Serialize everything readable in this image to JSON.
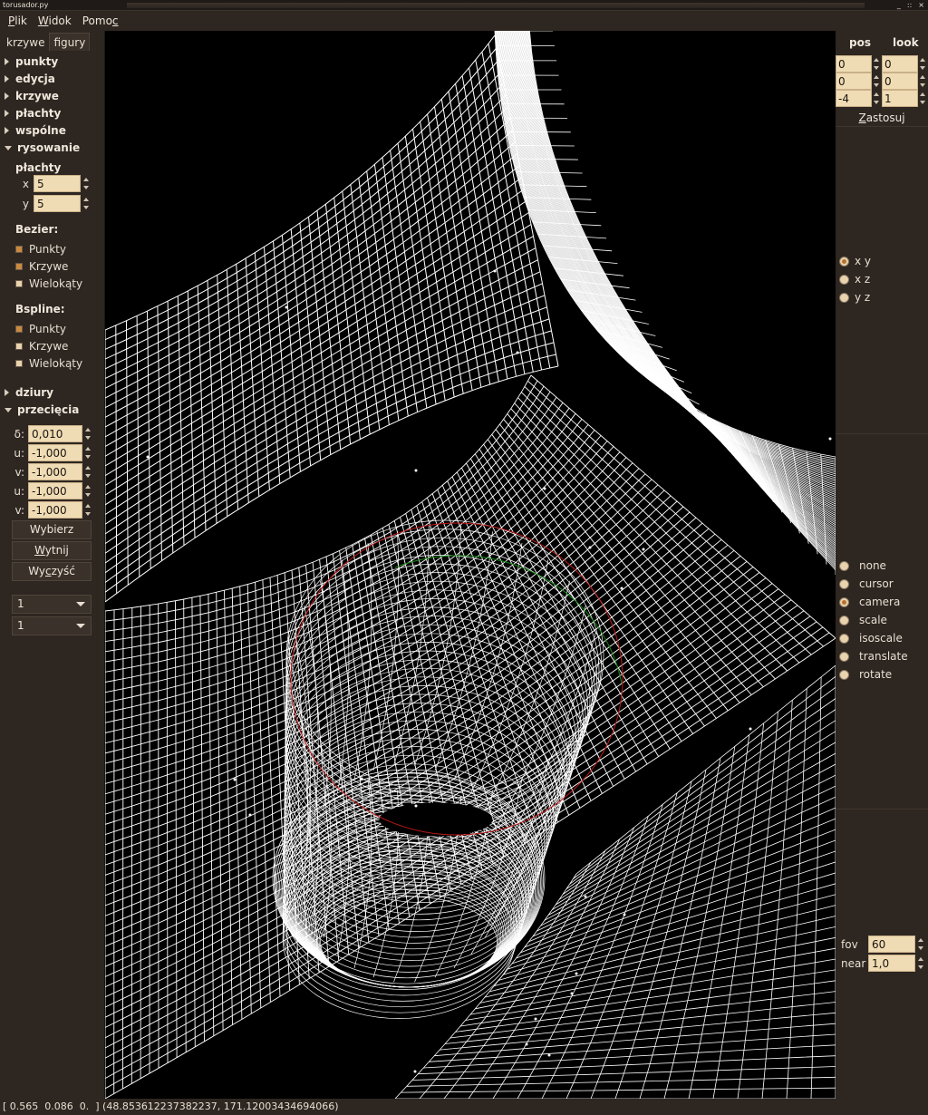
{
  "window": {
    "title": "torusador.py",
    "buttons": [
      "_",
      "::",
      "×"
    ]
  },
  "menu": [
    {
      "before": "",
      "ul": "P",
      "after": "lik"
    },
    {
      "before": "",
      "ul": "W",
      "after": "idok"
    },
    {
      "before": "Pomo",
      "ul": "c",
      "after": ""
    }
  ],
  "left": {
    "tabs": [
      "krzywe",
      "figury"
    ],
    "sections": {
      "punkty": "punkty",
      "edycja": "edycja",
      "krzywe": "krzywe",
      "plachty": "płachty",
      "wspolne": "wspólne",
      "rysowanie": "rysowanie",
      "dziury": "dziury",
      "przeciecia": "przecięcia"
    },
    "rysowanie": {
      "plachty_label": "płachty",
      "x_label": "x",
      "x_value": "5",
      "y_label": "y",
      "y_value": "5",
      "bezier_label": "Bezier:",
      "bezier_items": [
        {
          "label": "Punkty",
          "checked": true
        },
        {
          "label": "Krzywe",
          "checked": true
        },
        {
          "label": "Wielokąty",
          "checked": false
        }
      ],
      "bspline_label": "Bspline:",
      "bspline_items": [
        {
          "label": "Punkty",
          "checked": true
        },
        {
          "label": "Krzywe",
          "checked": false
        },
        {
          "label": "Wielokąty",
          "checked": false
        }
      ]
    },
    "przeciecia": {
      "fields": [
        {
          "label": "δ:",
          "value": "0,010"
        },
        {
          "label": "u:",
          "value": "-1,000"
        },
        {
          "label": "v:",
          "value": "-1,000"
        },
        {
          "label": "u:",
          "value": "-1,000"
        },
        {
          "label": "v:",
          "value": "-1,000"
        }
      ],
      "buttons": {
        "wybierz": "Wybierz",
        "wytnij": {
          "ul": "W",
          "after": "ytnij"
        },
        "wyczysc": {
          "before": "Wy",
          "ul": "c",
          "after": "zyść"
        }
      },
      "combos": [
        "1",
        "1"
      ]
    }
  },
  "right": {
    "pos_header": "pos",
    "look_header": "look",
    "pos": [
      "0",
      "0",
      "-4"
    ],
    "look": [
      "0",
      "0",
      "1"
    ],
    "apply": {
      "ul": "Z",
      "after": "astosuj"
    },
    "planes": [
      {
        "label": "x y",
        "selected": true
      },
      {
        "label": "x z",
        "selected": false
      },
      {
        "label": "y z",
        "selected": false
      }
    ],
    "modes": [
      {
        "label": "none",
        "selected": false
      },
      {
        "label": "cursor",
        "selected": false
      },
      {
        "label": "camera",
        "selected": true
      },
      {
        "label": "scale",
        "selected": false
      },
      {
        "label": "isoscale",
        "selected": false
      },
      {
        "label": "translate",
        "selected": false
      },
      {
        "label": "rotate",
        "selected": false
      }
    ],
    "fov_label": "fov",
    "fov_value": "60",
    "near_label": "near",
    "near_value": "1,0"
  },
  "status": "[ 0.565  0.086  0.  ] (48.853612237382237, 171.12003434694066)",
  "colors": {
    "panel_bg": "#2e2621",
    "entry_bg": "#f0dcb4",
    "check_on": "#c98a3f",
    "radio_dot": "#b8712a",
    "viewport_bg": "#000000",
    "wireframe": "#ffffff",
    "curve_red": "#c01818",
    "curve_green": "#1a8a1a"
  }
}
